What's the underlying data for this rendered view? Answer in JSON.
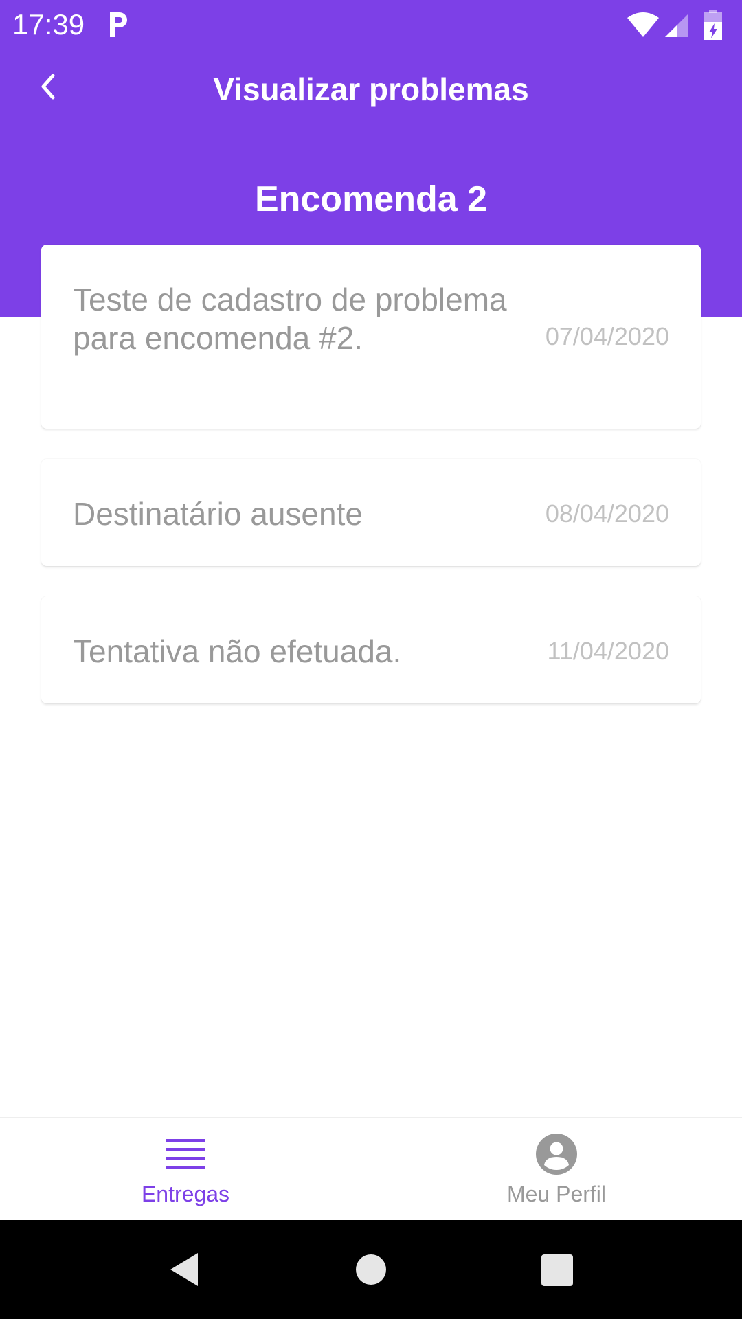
{
  "status_bar": {
    "time": "17:39"
  },
  "app_bar": {
    "title": "Visualizar problemas",
    "back_icon": "chevron-left-icon"
  },
  "order": {
    "title": "Encomenda 2"
  },
  "problems": [
    {
      "description": "Teste de cadastro de problema para encomenda #2.",
      "date": "07/04/2020"
    },
    {
      "description": "Destinatário ausente",
      "date": "08/04/2020"
    },
    {
      "description": "Tentativa não efetuada.",
      "date": "11/04/2020"
    }
  ],
  "bottom_nav": {
    "items": [
      {
        "label": "Entregas",
        "icon": "list-icon",
        "active": true
      },
      {
        "label": "Meu Perfil",
        "icon": "account-circle-icon",
        "active": false
      }
    ]
  },
  "colors": {
    "brand": "#7d40e7",
    "inactive": "#999999",
    "date": "#c1c1c1"
  }
}
